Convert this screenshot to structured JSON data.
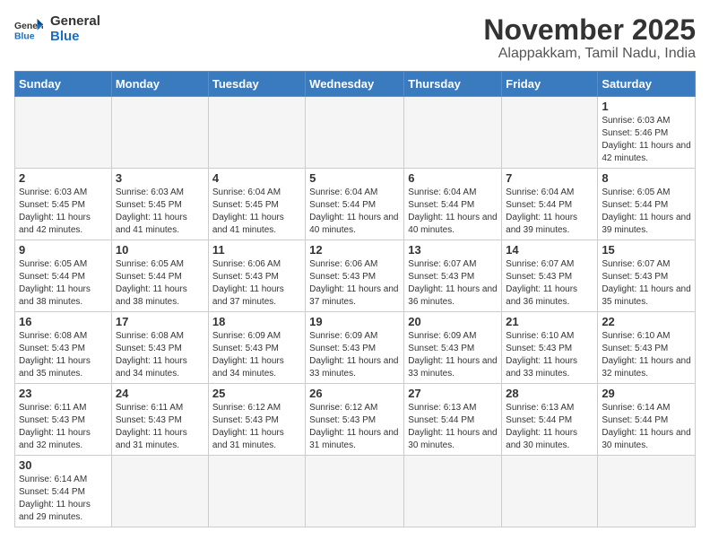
{
  "header": {
    "logo_general": "General",
    "logo_blue": "Blue",
    "month_title": "November 2025",
    "location": "Alappakkam, Tamil Nadu, India"
  },
  "weekdays": [
    "Sunday",
    "Monday",
    "Tuesday",
    "Wednesday",
    "Thursday",
    "Friday",
    "Saturday"
  ],
  "weeks": [
    [
      {
        "day": "",
        "info": ""
      },
      {
        "day": "",
        "info": ""
      },
      {
        "day": "",
        "info": ""
      },
      {
        "day": "",
        "info": ""
      },
      {
        "day": "",
        "info": ""
      },
      {
        "day": "",
        "info": ""
      },
      {
        "day": "1",
        "info": "Sunrise: 6:03 AM\nSunset: 5:46 PM\nDaylight: 11 hours and 42 minutes."
      }
    ],
    [
      {
        "day": "2",
        "info": "Sunrise: 6:03 AM\nSunset: 5:45 PM\nDaylight: 11 hours and 42 minutes."
      },
      {
        "day": "3",
        "info": "Sunrise: 6:03 AM\nSunset: 5:45 PM\nDaylight: 11 hours and 41 minutes."
      },
      {
        "day": "4",
        "info": "Sunrise: 6:04 AM\nSunset: 5:45 PM\nDaylight: 11 hours and 41 minutes."
      },
      {
        "day": "5",
        "info": "Sunrise: 6:04 AM\nSunset: 5:44 PM\nDaylight: 11 hours and 40 minutes."
      },
      {
        "day": "6",
        "info": "Sunrise: 6:04 AM\nSunset: 5:44 PM\nDaylight: 11 hours and 40 minutes."
      },
      {
        "day": "7",
        "info": "Sunrise: 6:04 AM\nSunset: 5:44 PM\nDaylight: 11 hours and 39 minutes."
      },
      {
        "day": "8",
        "info": "Sunrise: 6:05 AM\nSunset: 5:44 PM\nDaylight: 11 hours and 39 minutes."
      }
    ],
    [
      {
        "day": "9",
        "info": "Sunrise: 6:05 AM\nSunset: 5:44 PM\nDaylight: 11 hours and 38 minutes."
      },
      {
        "day": "10",
        "info": "Sunrise: 6:05 AM\nSunset: 5:44 PM\nDaylight: 11 hours and 38 minutes."
      },
      {
        "day": "11",
        "info": "Sunrise: 6:06 AM\nSunset: 5:43 PM\nDaylight: 11 hours and 37 minutes."
      },
      {
        "day": "12",
        "info": "Sunrise: 6:06 AM\nSunset: 5:43 PM\nDaylight: 11 hours and 37 minutes."
      },
      {
        "day": "13",
        "info": "Sunrise: 6:07 AM\nSunset: 5:43 PM\nDaylight: 11 hours and 36 minutes."
      },
      {
        "day": "14",
        "info": "Sunrise: 6:07 AM\nSunset: 5:43 PM\nDaylight: 11 hours and 36 minutes."
      },
      {
        "day": "15",
        "info": "Sunrise: 6:07 AM\nSunset: 5:43 PM\nDaylight: 11 hours and 35 minutes."
      }
    ],
    [
      {
        "day": "16",
        "info": "Sunrise: 6:08 AM\nSunset: 5:43 PM\nDaylight: 11 hours and 35 minutes."
      },
      {
        "day": "17",
        "info": "Sunrise: 6:08 AM\nSunset: 5:43 PM\nDaylight: 11 hours and 34 minutes."
      },
      {
        "day": "18",
        "info": "Sunrise: 6:09 AM\nSunset: 5:43 PM\nDaylight: 11 hours and 34 minutes."
      },
      {
        "day": "19",
        "info": "Sunrise: 6:09 AM\nSunset: 5:43 PM\nDaylight: 11 hours and 33 minutes."
      },
      {
        "day": "20",
        "info": "Sunrise: 6:09 AM\nSunset: 5:43 PM\nDaylight: 11 hours and 33 minutes."
      },
      {
        "day": "21",
        "info": "Sunrise: 6:10 AM\nSunset: 5:43 PM\nDaylight: 11 hours and 33 minutes."
      },
      {
        "day": "22",
        "info": "Sunrise: 6:10 AM\nSunset: 5:43 PM\nDaylight: 11 hours and 32 minutes."
      }
    ],
    [
      {
        "day": "23",
        "info": "Sunrise: 6:11 AM\nSunset: 5:43 PM\nDaylight: 11 hours and 32 minutes."
      },
      {
        "day": "24",
        "info": "Sunrise: 6:11 AM\nSunset: 5:43 PM\nDaylight: 11 hours and 31 minutes."
      },
      {
        "day": "25",
        "info": "Sunrise: 6:12 AM\nSunset: 5:43 PM\nDaylight: 11 hours and 31 minutes."
      },
      {
        "day": "26",
        "info": "Sunrise: 6:12 AM\nSunset: 5:43 PM\nDaylight: 11 hours and 31 minutes."
      },
      {
        "day": "27",
        "info": "Sunrise: 6:13 AM\nSunset: 5:44 PM\nDaylight: 11 hours and 30 minutes."
      },
      {
        "day": "28",
        "info": "Sunrise: 6:13 AM\nSunset: 5:44 PM\nDaylight: 11 hours and 30 minutes."
      },
      {
        "day": "29",
        "info": "Sunrise: 6:14 AM\nSunset: 5:44 PM\nDaylight: 11 hours and 30 minutes."
      }
    ],
    [
      {
        "day": "30",
        "info": "Sunrise: 6:14 AM\nSunset: 5:44 PM\nDaylight: 11 hours and 29 minutes."
      },
      {
        "day": "",
        "info": ""
      },
      {
        "day": "",
        "info": ""
      },
      {
        "day": "",
        "info": ""
      },
      {
        "day": "",
        "info": ""
      },
      {
        "day": "",
        "info": ""
      },
      {
        "day": "",
        "info": ""
      }
    ]
  ]
}
